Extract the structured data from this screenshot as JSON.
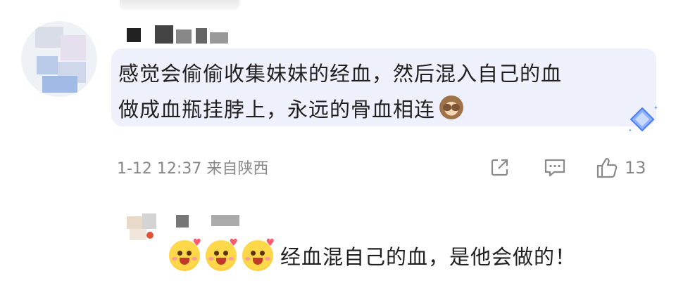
{
  "comment": {
    "text_line1": "感觉会偷偷收集妹妹的经血，然后混入自己的血",
    "text_line2": "做成血瓶挂脖上，永远的骨血相连",
    "emoji": "monkey-covering-eyes",
    "meta": "1-12 12:37 来自陕西",
    "like_count": "13"
  },
  "reply": {
    "emojis": [
      "blushing-face-with-hearts",
      "blushing-face-with-hearts",
      "blushing-face-with-hearts"
    ],
    "text": "经血混自己的血，是他会做的！"
  },
  "colors": {
    "bubble": "#eef1fb",
    "meta": "#888888",
    "emoji_yellow": "#ffd84a"
  }
}
